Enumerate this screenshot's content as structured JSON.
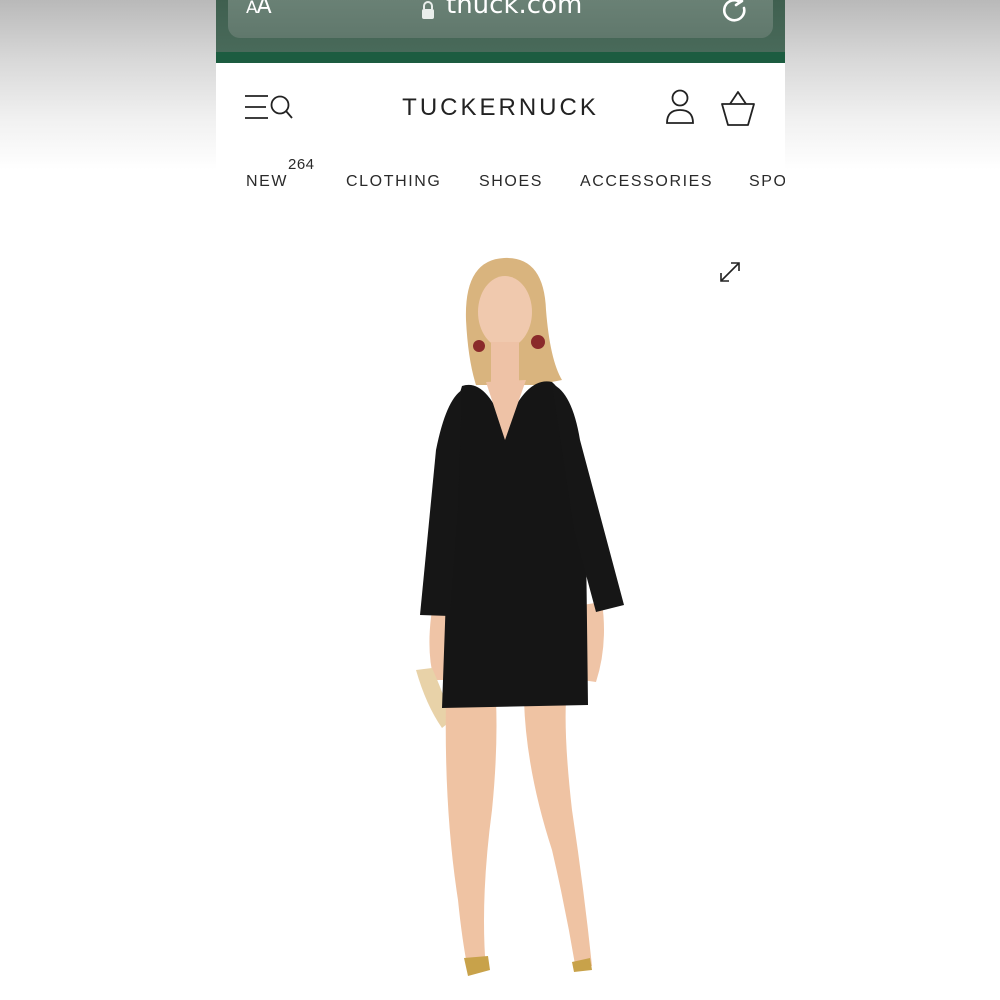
{
  "browser": {
    "text_size_small": "A",
    "text_size_large": "A",
    "url": "tnuck.com",
    "lock_icon": "lock-icon",
    "reload_icon": "reload-icon"
  },
  "header": {
    "logo": "TUCKERNUCK",
    "menu_icon": "menu-search-icon",
    "account_icon": "account-icon",
    "bag_icon": "shopping-bag-icon"
  },
  "nav": {
    "items": [
      {
        "label": "NEW",
        "count": "264"
      },
      {
        "label": "CLOTHING"
      },
      {
        "label": "SHOES"
      },
      {
        "label": "ACCESSORIES"
      },
      {
        "label": "SPO"
      }
    ]
  },
  "product": {
    "expand_icon": "expand-icon"
  },
  "colors": {
    "brand_green": "#1c5c40",
    "browser_chrome": "#496a5a",
    "dress": "#151515"
  }
}
